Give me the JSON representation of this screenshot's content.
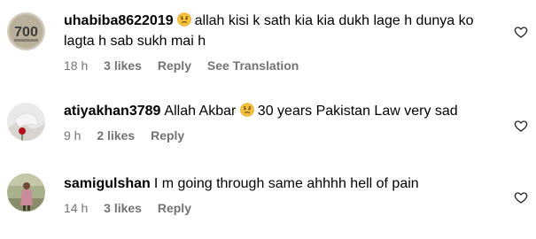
{
  "comments": [
    {
      "username": "uhabiba8622019",
      "emoji": "sad-face-emoji",
      "text": "allah kisi k sath kia kia dukh lage h dunya ko lagta h sab sukh mai h",
      "time": "18 h",
      "likes": "3 likes",
      "reply": "Reply",
      "translate": "See Translation",
      "avatar_text": "700"
    },
    {
      "username": "atiyakhan3789",
      "text_before": "Allah Akbar",
      "emoji": "sad-face-emoji",
      "text_after": "30 years Pakistan Law very sad",
      "time": "9 h",
      "likes": "2 likes",
      "reply": "Reply"
    },
    {
      "username": "samigulshan",
      "text": "I m going through same ahhhh hell of pain",
      "time": "14 h",
      "likes": "3 likes",
      "reply": "Reply"
    }
  ],
  "colors": {
    "meta": "#737373",
    "text": "#000000",
    "emoji_face": "#f6c13c"
  },
  "icons": {
    "like": "heart-outline-icon"
  }
}
